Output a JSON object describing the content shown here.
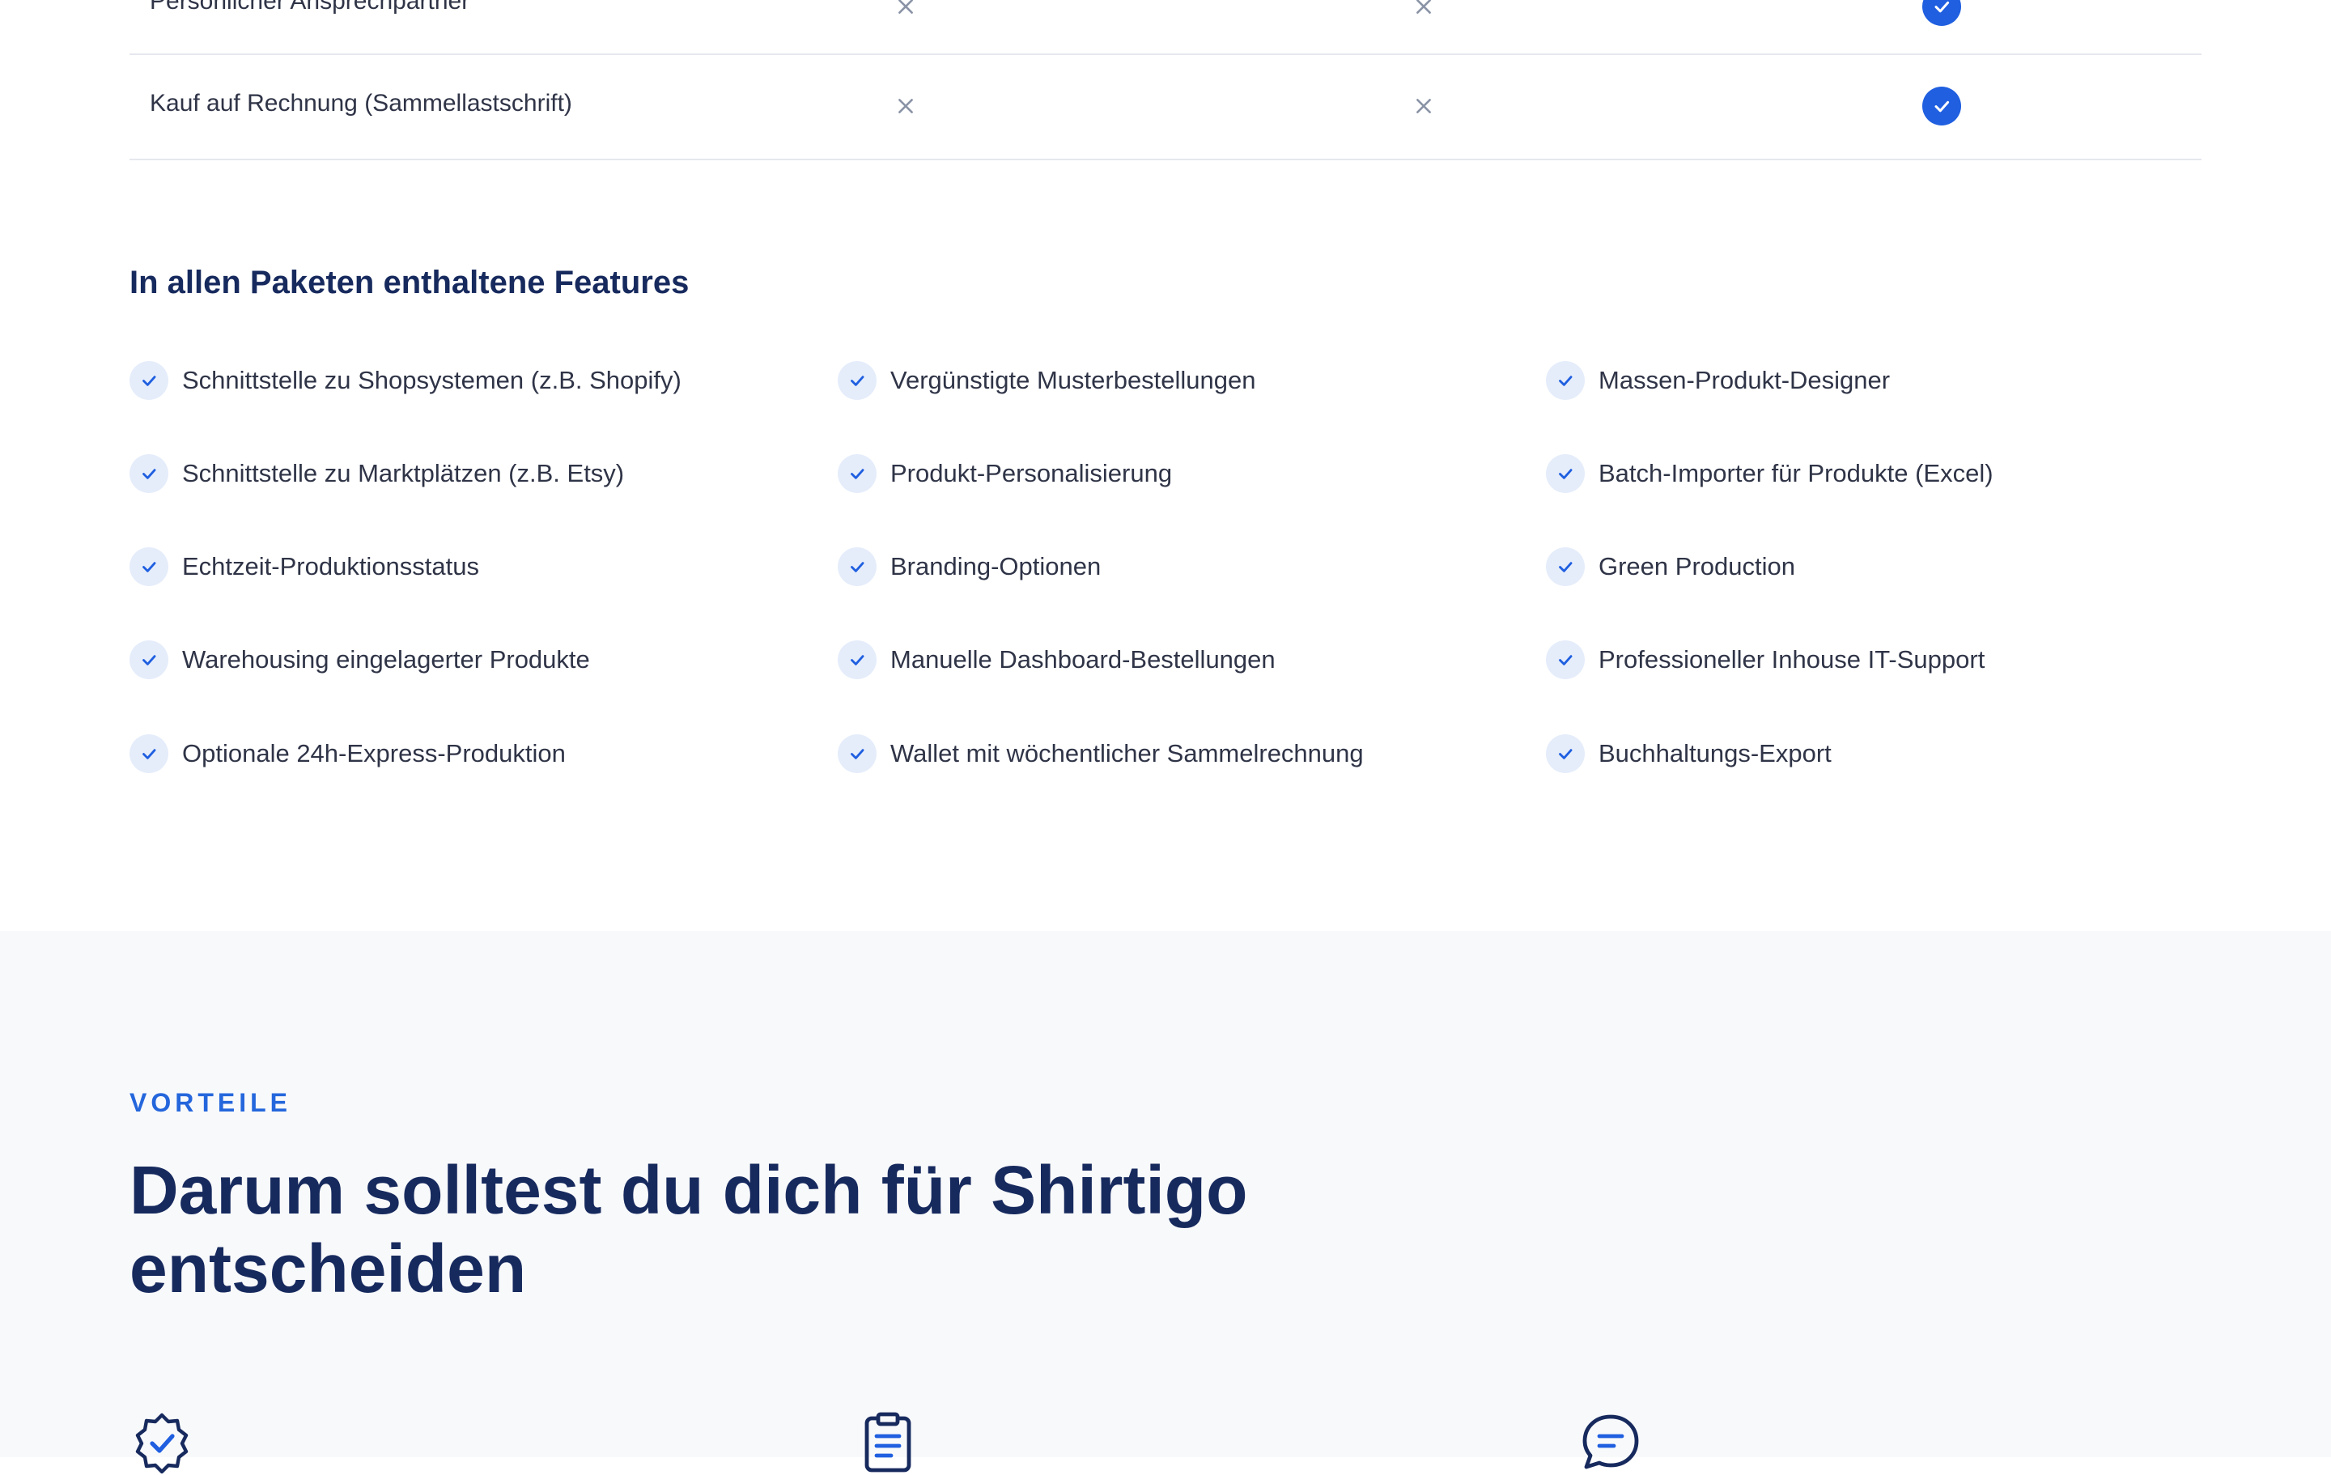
{
  "comparison_table": {
    "rows": [
      {
        "label": "Persönlicher Ansprechpartner",
        "values": [
          "no",
          "no",
          "yes"
        ]
      },
      {
        "label": "Kauf auf Rechnung (Sammellastschrift)",
        "values": [
          "no",
          "no",
          "yes"
        ]
      }
    ]
  },
  "included_features": {
    "title": "In allen Paketen enthaltene Features",
    "columns": [
      [
        "Schnittstelle zu Shopsystemen (z.B. Shopify)",
        "Schnittstelle zu Marktplätzen (z.B. Etsy)",
        "Echtzeit-Produktionsstatus",
        "Warehousing eingelagerter Produkte",
        "Optionale 24h-Express-Produktion"
      ],
      [
        "Vergünstigte Musterbestellungen",
        "Produkt-Personalisierung",
        "Branding-Optionen",
        "Manuelle Dashboard-Bestellungen",
        "Wallet mit wöchentlicher Sammelrechnung"
      ],
      [
        "Massen-Produkt-Designer",
        "Batch-Importer für Produkte (Excel)",
        "Green Production",
        "Professioneller Inhouse IT-Support",
        "Buchhaltungs-Export"
      ]
    ]
  },
  "benefits": {
    "eyebrow": "VORTEILE",
    "headline": "Darum solltest du dich für Shirtigo entscheiden",
    "icons": [
      "badge-check-icon",
      "clipboard-icon",
      "chat-bubble-icon"
    ]
  },
  "colors": {
    "accent": "#1f5fe0",
    "heading": "#172a5e",
    "eyebrow": "#2466dc",
    "check_bg": "#e5edfb",
    "cross": "#8a93a6",
    "section_bg": "#f8f9fb"
  }
}
